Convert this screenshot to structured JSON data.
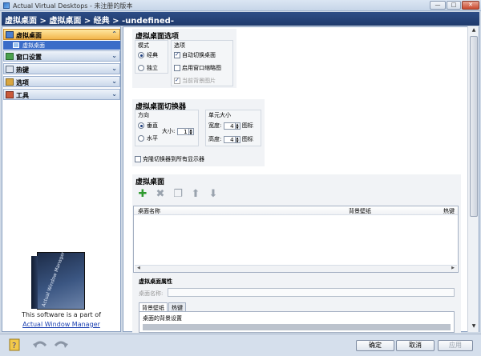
{
  "window": {
    "title": "Actual Virtual Desktops - 未注册的版本",
    "min": "—",
    "max": "□",
    "close": "✕"
  },
  "breadcrumb": "虚拟桌面 > 虚拟桌面 > 经典 > -undefined-",
  "sidebar": {
    "items": [
      {
        "label": "虚拟桌面",
        "active": true
      },
      {
        "label": "窗口设置"
      },
      {
        "label": "热键"
      },
      {
        "label": "选项"
      },
      {
        "label": "工具"
      }
    ],
    "sub_item": "虚拟桌面",
    "chevron_up": "⌃",
    "chevron_down": "⌄",
    "promo_text": "This software is a part of",
    "promo_link": "Actual Window Manager",
    "box_label": "Actual Window Manager"
  },
  "options": {
    "title": "虚拟桌面选项",
    "mode_label": "模式",
    "mode_classic": "经典",
    "mode_independent": "独立",
    "opts_label": "选项",
    "auto_switch": "自动切换桌面",
    "enable_thumb": "启用窗口缩略图",
    "current_bg": "当前背景图片"
  },
  "switcher": {
    "title": "虚拟桌面切换器",
    "dir_label": "方向",
    "vertical": "垂直",
    "horizontal": "水平",
    "size_label": "大小:",
    "size_value": "1",
    "cell_label": "单元大小",
    "width_label": "宽度:",
    "width_value": "4",
    "height_label": "高度:",
    "height_value": "4",
    "icon_unit": "图标",
    "clone": "克隆切换器到所有显示器"
  },
  "desktops": {
    "title": "虚拟桌面",
    "toolbar": {
      "add": "✚",
      "delete": "✖",
      "copy": "❐",
      "up": "⬆",
      "down": "⬇"
    },
    "columns": [
      "桌面名称",
      "背景壁纸",
      "热键"
    ],
    "scroll_left": "◀",
    "scroll_right": "▶"
  },
  "props": {
    "title": "虚拟桌面属性",
    "name_label": "桌面名称:",
    "name_value": "",
    "tabs": [
      "背景壁纸",
      "热键"
    ],
    "bg_settings": "桌面的背景设置"
  },
  "scrollbar": {
    "up": "▲",
    "down": "▼"
  },
  "buttons": {
    "ok": "确定",
    "cancel": "取消",
    "apply": "应用"
  },
  "colors": {
    "accent": "#1f3a6c",
    "active_nav": "#f3b54a",
    "selection": "#3a6cc8"
  }
}
